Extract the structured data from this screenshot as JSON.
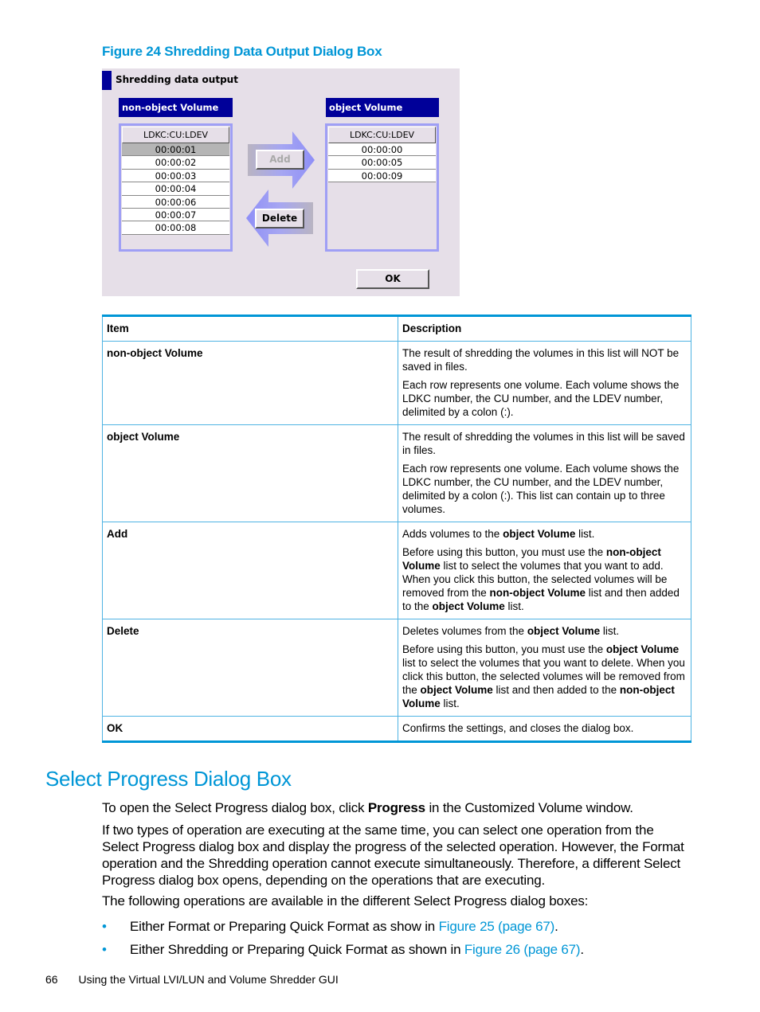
{
  "figure": {
    "caption": "Figure 24 Shredding Data Output Dialog Box",
    "dialog": {
      "title": "Shredding data output",
      "non_object_list": {
        "header": "non-object Volume",
        "column": "LDKC:CU:LDEV",
        "rows": [
          "00:00:01",
          "00:00:02",
          "00:00:03",
          "00:00:04",
          "00:00:06",
          "00:00:07",
          "00:00:08"
        ],
        "selected_index": 0
      },
      "object_list": {
        "header": "object Volume",
        "column": "LDKC:CU:LDEV",
        "rows": [
          "00:00:00",
          "00:00:05",
          "00:00:09"
        ]
      },
      "add_button": "Add",
      "delete_button": "Delete",
      "ok_button": "OK"
    }
  },
  "table": {
    "headers": [
      "Item",
      "Description"
    ],
    "rows": [
      {
        "item": "non-object Volume",
        "paragraphs": [
          [
            {
              "t": "The result of shredding the volumes in this list will NOT be saved in files."
            }
          ],
          [
            {
              "t": "Each row represents one volume. Each volume shows the LDKC number, the CU number, and the LDEV number, delimited by a colon (:)."
            }
          ]
        ]
      },
      {
        "item": "object Volume",
        "paragraphs": [
          [
            {
              "t": "The result of shredding the volumes in this list will be saved in files."
            }
          ],
          [
            {
              "t": "Each row represents one volume. Each volume shows the LDKC number, the CU number, and the LDEV number, delimited by a colon (:). This list can contain up to three volumes."
            }
          ]
        ]
      },
      {
        "item": "Add",
        "paragraphs": [
          [
            {
              "t": "Adds volumes to the "
            },
            {
              "t": "object Volume",
              "b": true
            },
            {
              "t": " list."
            }
          ],
          [
            {
              "t": "Before using this button, you must use the "
            },
            {
              "t": "non-object Volume",
              "b": true
            },
            {
              "t": " list to select the volumes that you want to add. When you click this button, the selected volumes will be removed from the "
            },
            {
              "t": "non-object Volume",
              "b": true
            },
            {
              "t": " list and then added to the "
            },
            {
              "t": "object Volume",
              "b": true
            },
            {
              "t": " list."
            }
          ]
        ]
      },
      {
        "item": "Delete",
        "paragraphs": [
          [
            {
              "t": "Deletes volumes from the "
            },
            {
              "t": "object Volume",
              "b": true
            },
            {
              "t": " list."
            }
          ],
          [
            {
              "t": "Before using this button, you must use the "
            },
            {
              "t": "object Volume",
              "b": true
            },
            {
              "t": " list to select the volumes that you want to delete. When you click this button, the selected volumes will be removed from the "
            },
            {
              "t": "object Volume",
              "b": true
            },
            {
              "t": " list and then added to the "
            },
            {
              "t": "non-object Volume",
              "b": true
            },
            {
              "t": " list."
            }
          ]
        ]
      },
      {
        "item": "OK",
        "paragraphs": [
          [
            {
              "t": "Confirms the settings, and closes the dialog box."
            }
          ]
        ]
      }
    ]
  },
  "section": {
    "heading": "Select Progress Dialog Box",
    "para1": [
      {
        "t": "To open the Select Progress dialog box, click "
      },
      {
        "t": "Progress",
        "b": true
      },
      {
        "t": " in the Customized Volume window."
      }
    ],
    "para2": "If two types of operation are executing at the same time, you can select one operation from the Select Progress dialog box and display the progress of the selected operation. However, the Format operation and the Shredding operation cannot execute simultaneously. Therefore, a different Select Progress dialog box opens, depending on the operations that are executing.",
    "para3": "The following operations are available in the different Select Progress dialog boxes:",
    "bullets": [
      {
        "text": "Either Format or Preparing Quick Format as show in ",
        "link": "Figure 25 (page 67)",
        "end": "."
      },
      {
        "text": "Either Shredding or Preparing Quick Format as shown in ",
        "link": "Figure 26 (page 67)",
        "end": "."
      }
    ],
    "bullet_glyph": "•"
  },
  "footer": {
    "page_number": "66",
    "title": "Using the Virtual LVI/LUN and Volume Shredder GUI"
  }
}
